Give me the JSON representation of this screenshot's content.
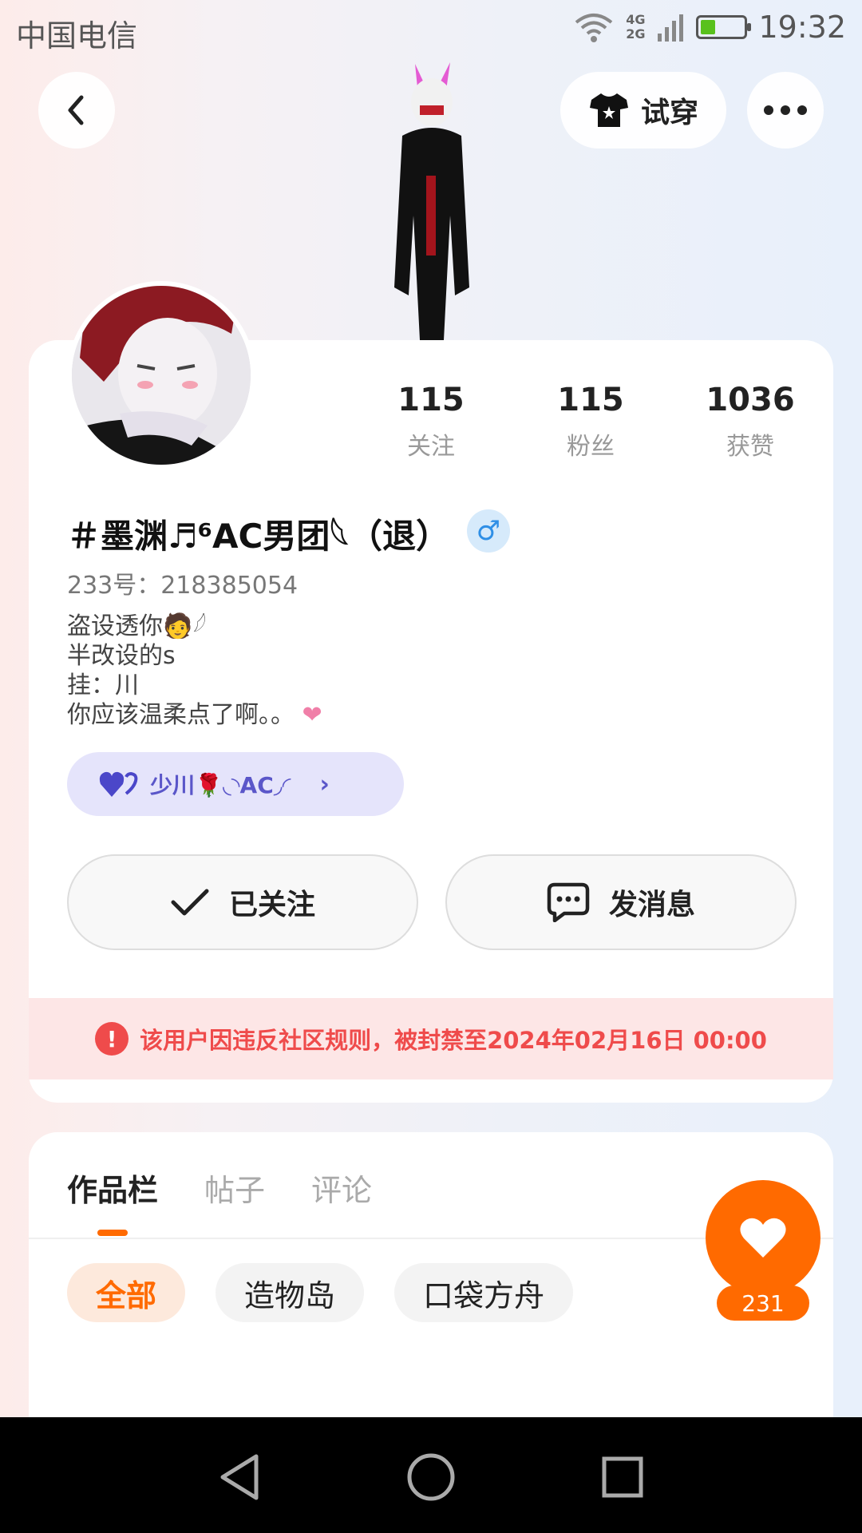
{
  "status_bar": {
    "carrier": "中国电信",
    "network": "4G\n2G",
    "time": "19:32"
  },
  "header": {
    "back_icon": "chevron-left-icon",
    "try_on_label": "试穿",
    "try_on_icon": "tshirt-icon",
    "more_icon": "more-dots-icon"
  },
  "profile": {
    "stats": [
      {
        "value": "115",
        "label": "关注"
      },
      {
        "value": "115",
        "label": "粉丝"
      },
      {
        "value": "1036",
        "label": "获赞"
      }
    ],
    "username": "＃墨渊♬⁶AC男团𓆩（退）",
    "gender": "♂",
    "user_id": "233号：218385054",
    "bio_lines": [
      "盗设透你🧑𓆪",
      "半改设的s",
      "挂：川",
      "你应该温柔点了啊。。"
    ],
    "fan_badge": "少川🌹◟◝AC◞◜",
    "follow_label": "已关注",
    "message_label": "发消息",
    "ban_notice": "该用户因违反社区规则，被封禁至2024年02月16日 00:00"
  },
  "works": {
    "tabs": [
      "作品栏",
      "帖子",
      "评论"
    ],
    "chips": [
      "全部",
      "造物岛",
      "口袋方舟"
    ],
    "like_count": "231"
  },
  "colors": {
    "accent": "#ff6a00",
    "ban_text": "#ef4b4b",
    "ban_bg": "#fde6e6",
    "badge_bg": "#e5e4fb"
  }
}
